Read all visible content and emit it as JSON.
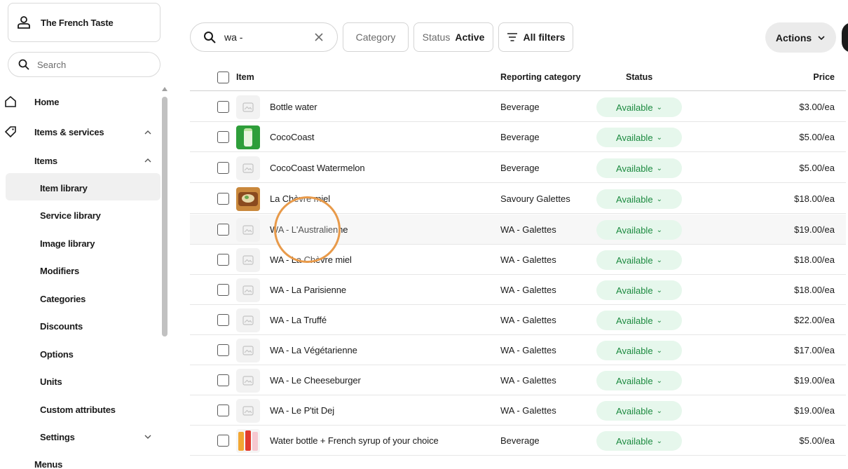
{
  "account": {
    "name": "The French Taste"
  },
  "sidebar": {
    "search_placeholder": "Search",
    "home": "Home",
    "items_services": "Items & services",
    "items": "Items",
    "sub": [
      "Item library",
      "Service library",
      "Image library",
      "Modifiers",
      "Categories",
      "Discounts",
      "Options",
      "Units",
      "Custom attributes"
    ],
    "settings": "Settings",
    "menus": "Menus"
  },
  "toolbar": {
    "search_value": "wa -",
    "category_label": "Category",
    "status_label": "Status",
    "status_value": "Active",
    "filters_label": "All filters",
    "actions_label": "Actions"
  },
  "table": {
    "headers": {
      "item": "Item",
      "category": "Reporting category",
      "status": "Status",
      "price": "Price"
    },
    "rows": [
      {
        "name": "Bottle water",
        "category": "Beverage",
        "status": "Available",
        "price": "$3.00/ea",
        "thumb": "placeholder-image-icon"
      },
      {
        "name": "CocoCoast",
        "category": "Beverage",
        "status": "Available",
        "price": "$5.00/ea",
        "thumb": "green-bottle"
      },
      {
        "name": "CocoCoast Watermelon",
        "category": "Beverage",
        "status": "Available",
        "price": "$5.00/ea",
        "thumb": "placeholder-image-icon"
      },
      {
        "name": "La Chèvre miel",
        "category": "Savoury Galettes",
        "status": "Available",
        "price": "$18.00/ea",
        "thumb": "galette-photo"
      },
      {
        "name": "WA - L'Australienne",
        "category": "WA - Galettes",
        "status": "Available",
        "price": "$19.00/ea",
        "thumb": "placeholder-image-icon"
      },
      {
        "name": "WA - La Chèvre miel",
        "category": "WA - Galettes",
        "status": "Available",
        "price": "$18.00/ea",
        "thumb": "placeholder-image-icon"
      },
      {
        "name": "WA - La Parisienne",
        "category": "WA - Galettes",
        "status": "Available",
        "price": "$18.00/ea",
        "thumb": "placeholder-image-icon"
      },
      {
        "name": "WA - La Truffé",
        "category": "WA - Galettes",
        "status": "Available",
        "price": "$22.00/ea",
        "thumb": "placeholder-image-icon"
      },
      {
        "name": "WA - La Végétarienne",
        "category": "WA - Galettes",
        "status": "Available",
        "price": "$17.00/ea",
        "thumb": "placeholder-image-icon"
      },
      {
        "name": "WA - Le Cheeseburger",
        "category": "WA - Galettes",
        "status": "Available",
        "price": "$19.00/ea",
        "thumb": "placeholder-image-icon"
      },
      {
        "name": "WA - Le P'tit Dej",
        "category": "WA - Galettes",
        "status": "Available",
        "price": "$19.00/ea",
        "thumb": "placeholder-image-icon"
      },
      {
        "name": "Water bottle + French syrup of your choice",
        "category": "Beverage",
        "status": "Available",
        "price": "$5.00/ea",
        "thumb": "syrup-bottles-photo"
      }
    ]
  },
  "colors": {
    "available_bg": "#e6f7ec",
    "available_text": "#1b8a3f",
    "active_nav_bg": "#f0f0f0"
  }
}
